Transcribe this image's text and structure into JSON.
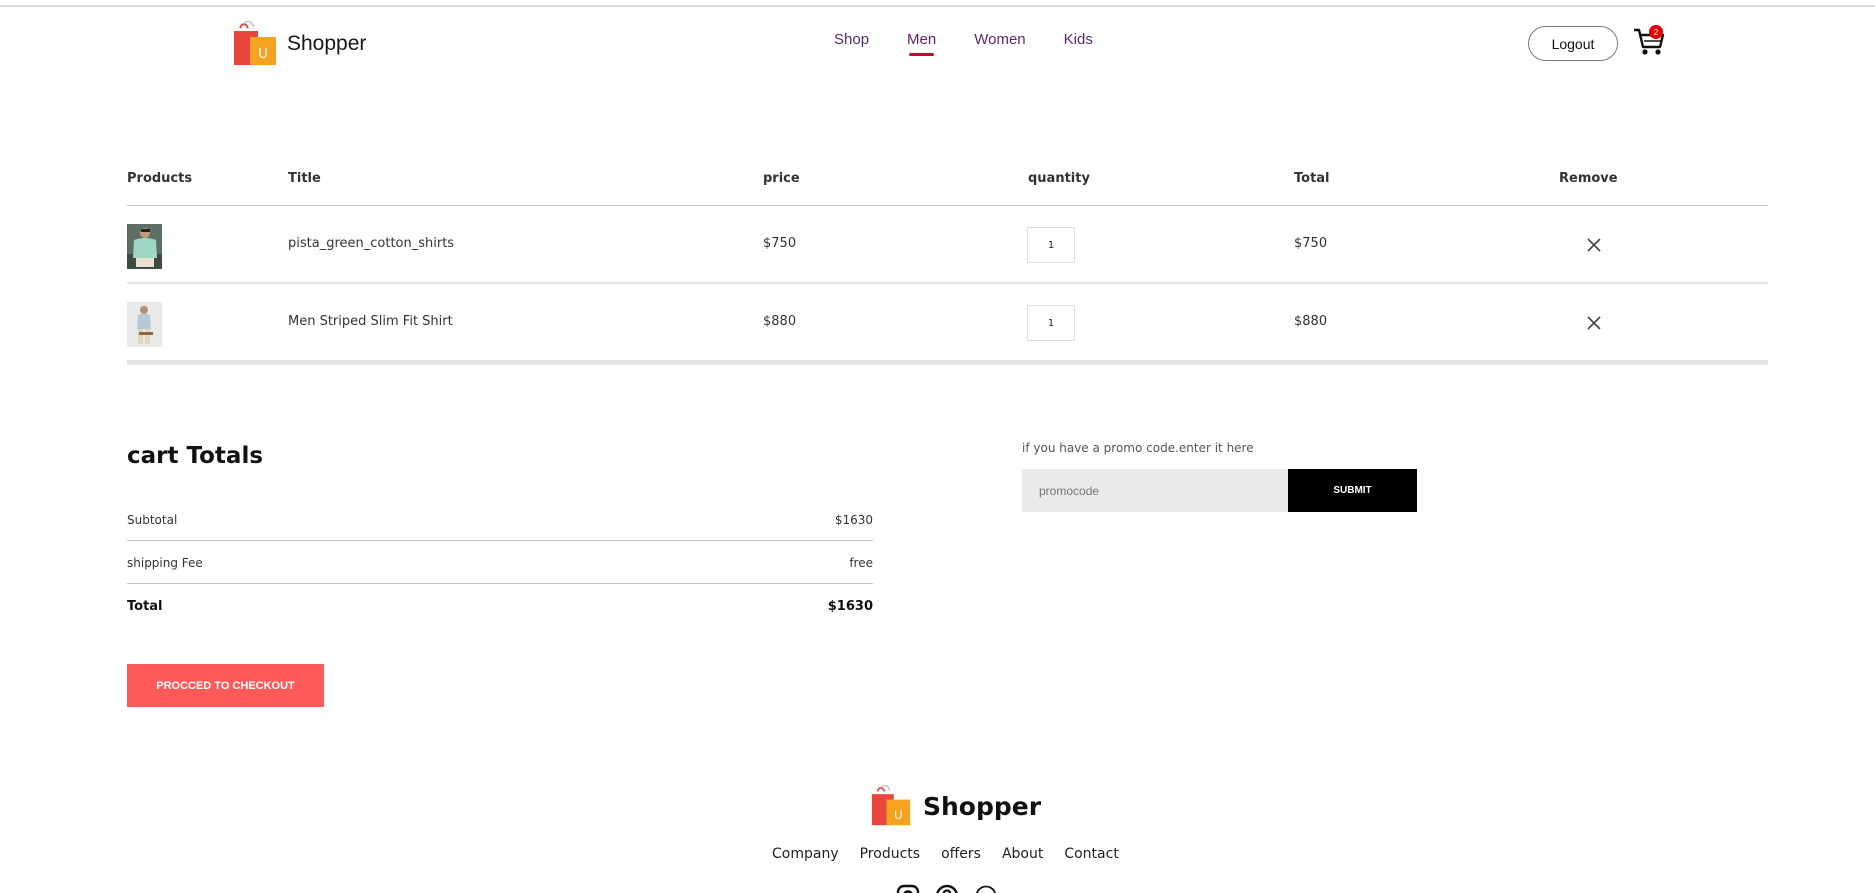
{
  "brand": {
    "name": "Shopper",
    "logo_letter": "U"
  },
  "nav": {
    "items": [
      {
        "label": "Shop",
        "active": false
      },
      {
        "label": "Men",
        "active": true
      },
      {
        "label": "Women",
        "active": false
      },
      {
        "label": "Kids",
        "active": false
      }
    ],
    "logout_label": "Logout",
    "cart_count": "2"
  },
  "cart": {
    "headers": [
      "Products",
      "Title",
      "price",
      "quantity",
      "Total",
      "Remove"
    ],
    "items": [
      {
        "title": "pista_green_cotton_shirts",
        "price": "$750",
        "quantity": "1",
        "total": "$750",
        "thumb": "green-shirt-photo"
      },
      {
        "title": "Men Striped Slim Fit Shirt",
        "price": "$880",
        "quantity": "1",
        "total": "$880",
        "thumb": "striped-shirt-photo"
      }
    ]
  },
  "totals": {
    "title": "cart Totals",
    "subtotal_label": "Subtotal",
    "subtotal_value": "$1630",
    "shipping_label": "shipping Fee",
    "shipping_value": "free",
    "total_label": "Total",
    "total_value": "$1630",
    "checkout_label": "PROCCED TO CHECKOUT"
  },
  "promo": {
    "label": "if you have a promo code.enter it here",
    "placeholder": "promocode",
    "submit_label": "SUBMIT"
  },
  "footer": {
    "brand": "Shopper",
    "links": [
      "Company",
      "Products",
      "offers",
      "About",
      "Contact"
    ],
    "social_icons": [
      "instagram-icon",
      "pinterest-icon",
      "whatsapp-icon"
    ]
  },
  "colors": {
    "accent": "#ff5a5a",
    "nav_text": "#5a2a6e",
    "active_underline": "#b8112d",
    "badge": "#e10000"
  }
}
